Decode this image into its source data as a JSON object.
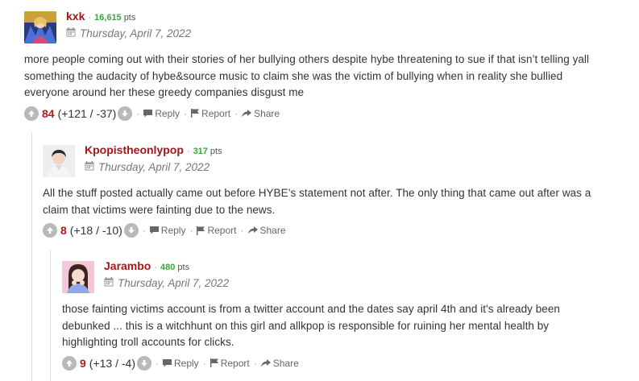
{
  "comments": [
    {
      "username": "kxk",
      "points": "16,615",
      "pts_label": "pts",
      "date": "Thursday, April 7, 2022",
      "body": "more people coming out with their stories of her bullying others despite hybe threatening to sue if that isn’t telling yall something the audacity of hybe&source music to claim she was the victim of bullying when in reality she bullied everyone around her these greedy companies disgust me",
      "score": "84",
      "breakdown": "(+121 / -37)",
      "reply_label": "Reply",
      "report_label": "Report",
      "share_label": "Share"
    },
    {
      "username": "Kpopistheonlypop",
      "points": "317",
      "pts_label": "pts",
      "date": "Thursday, April 7, 2022",
      "body": "All the stuff posted actually came out before HYBE’s statement not after. The only thing that came out after was a claim that victims were fainting due to the news.",
      "score": "8",
      "breakdown": "(+18 / -10)",
      "reply_label": "Reply",
      "report_label": "Report",
      "share_label": "Share"
    },
    {
      "username": "Jarambo",
      "points": "480",
      "pts_label": "pts",
      "date": "Thursday, April 7, 2022",
      "body": "those fainting victims account is from a twitter account and the dates say april 4th and it's already been debunked ... this is a witchhunt on this girl and allkpop is responsible for ruining her mental health by highlighting troll accounts for clicks.",
      "score": "9",
      "breakdown": "(+13 / -4)",
      "reply_label": "Reply",
      "report_label": "Report",
      "share_label": "Share"
    }
  ],
  "icons": {
    "upvote": "arrow-up-icon",
    "downvote": "arrow-down-icon",
    "reply": "speech-bubble-icon",
    "report": "flag-icon",
    "share": "share-arrow-icon",
    "date": "calendar-icon"
  },
  "colors": {
    "username": "#a01818",
    "points": "#3aa63a",
    "score": "#b01c1c",
    "vote_button": "#b9b9b9"
  }
}
